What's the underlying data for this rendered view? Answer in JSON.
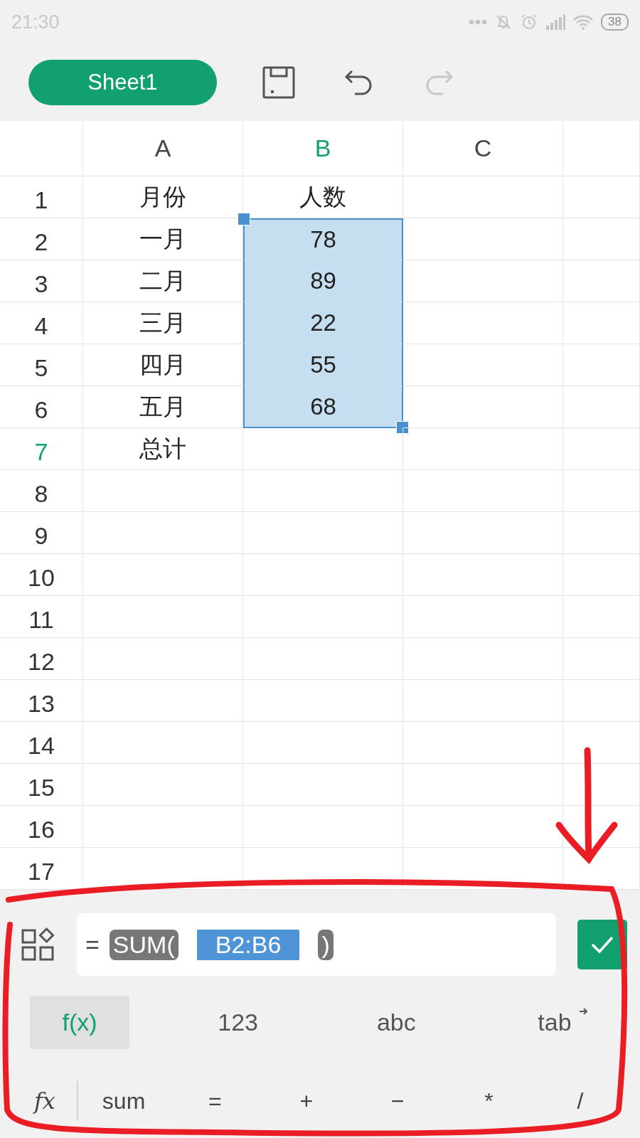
{
  "status_bar": {
    "time": "21:30",
    "battery": "38"
  },
  "toolbar": {
    "sheet_tab": "Sheet1",
    "undo": {
      "disabled": false
    },
    "redo": {
      "disabled": true
    }
  },
  "grid": {
    "columns": [
      {
        "label": "A",
        "selected": false
      },
      {
        "label": "B",
        "selected": true
      },
      {
        "label": "C",
        "selected": false
      }
    ],
    "rows": [
      {
        "header": "1",
        "selected": false,
        "in_range": false,
        "a": "月份",
        "b": "人数"
      },
      {
        "header": "2",
        "selected": false,
        "in_range": true,
        "a": "一月",
        "b": "78"
      },
      {
        "header": "3",
        "selected": false,
        "in_range": true,
        "a": "二月",
        "b": "89"
      },
      {
        "header": "4",
        "selected": false,
        "in_range": true,
        "a": "三月",
        "b": "22"
      },
      {
        "header": "5",
        "selected": false,
        "in_range": true,
        "a": "四月",
        "b": "55"
      },
      {
        "header": "6",
        "selected": false,
        "in_range": true,
        "a": "五月",
        "b": "68"
      },
      {
        "header": "7",
        "selected": true,
        "in_range": false,
        "a": "总计"
      },
      {
        "header": "8",
        "selected": false,
        "in_range": false
      },
      {
        "header": "9",
        "selected": false,
        "in_range": false
      },
      {
        "header": "10",
        "selected": false,
        "in_range": false
      },
      {
        "header": "11",
        "selected": false,
        "in_range": false
      },
      {
        "header": "12",
        "selected": false,
        "in_range": false
      },
      {
        "header": "13",
        "selected": false,
        "in_range": false
      },
      {
        "header": "14",
        "selected": false,
        "in_range": false
      },
      {
        "header": "15",
        "selected": false,
        "in_range": false
      },
      {
        "header": "16",
        "selected": false,
        "in_range": false
      },
      {
        "header": "17",
        "selected": false,
        "in_range": false
      }
    ]
  },
  "formula_bar": {
    "tokens": [
      {
        "kind": "operator",
        "text": "="
      },
      {
        "kind": "function",
        "text": "SUM("
      },
      {
        "kind": "reference",
        "text": "B2:B6"
      },
      {
        "kind": "paren",
        "text": ")"
      }
    ]
  },
  "keyboard_tabs": [
    {
      "label": "f(x)",
      "selected": true,
      "kind": "plain"
    },
    {
      "label": "123",
      "selected": false,
      "kind": "plain"
    },
    {
      "label": "abc",
      "selected": false,
      "kind": "plain"
    },
    {
      "label": "tab",
      "selected": false,
      "kind": "tab"
    }
  ],
  "quick_keys": {
    "label": "fx",
    "keys": [
      "sum",
      "=",
      "+",
      "−",
      "*",
      "/"
    ]
  },
  "annotations": {
    "arrow": true,
    "outline": true
  }
}
